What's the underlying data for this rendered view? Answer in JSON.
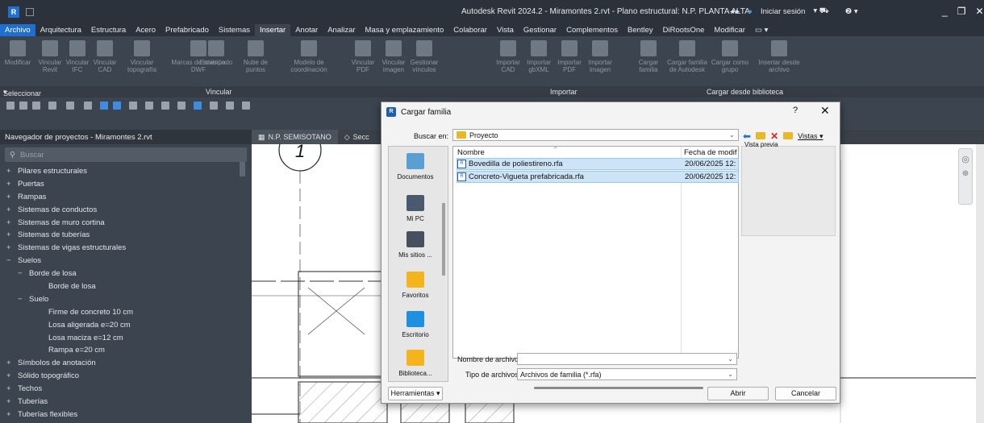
{
  "titlebar": {
    "logo": "R",
    "title": "Autodesk Revit 2024.2 - Miramontes 2.rvt - Plano estructural: N.P. PLANTA ALTA",
    "signin": "Iniciar sesión",
    "cart_icon": "cart-icon",
    "help_icon": "help-icon"
  },
  "menu": [
    "Archivo",
    "Arquitectura",
    "Estructura",
    "Acero",
    "Prefabricado",
    "Sistemas",
    "Insertar",
    "Anotar",
    "Analizar",
    "Masa y emplazamiento",
    "Colaborar",
    "Vista",
    "Gestionar",
    "Complementos",
    "Bentley",
    "DiRootsOne",
    "Modificar"
  ],
  "ribbon": {
    "buttons": [
      "Modificar",
      "Vincular Revit",
      "Vincular IFC",
      "Vincular CAD",
      "Vincular topografía",
      "Marcas de revisión DWF",
      "Estampado",
      "Nube de puntos",
      "Modelo de coordinación",
      "Vincular PDF",
      "Vincular imagen",
      "Gestionar vínculos",
      "Importar CAD",
      "Importar gbXML",
      "Importar PDF",
      "Importar imagen",
      "Cargar familia",
      "Cargar familia de Autodesk",
      "Cargar como grupo",
      "Insertar desde archivo"
    ],
    "panels": [
      "Seleccionar",
      "Vincular",
      "Importar",
      "Cargar desde biblioteca"
    ]
  },
  "tabs": [
    "N.P. SEMISOTANO",
    "Secc"
  ],
  "browser": {
    "title": "Navegador de proyectos - Miramontes 2.rvt",
    "search_placeholder": "Buscar",
    "items": [
      {
        "sym": "+",
        "label": "Pilares estructurales",
        "indent": 1
      },
      {
        "sym": "+",
        "label": "Puertas",
        "indent": 1
      },
      {
        "sym": "+",
        "label": "Rampas",
        "indent": 1
      },
      {
        "sym": "+",
        "label": "Sistemas de conductos",
        "indent": 1
      },
      {
        "sym": "+",
        "label": "Sistemas de muro cortina",
        "indent": 1
      },
      {
        "sym": "+",
        "label": "Sistemas de tuberías",
        "indent": 1
      },
      {
        "sym": "+",
        "label": "Sistemas de vigas estructurales",
        "indent": 1
      },
      {
        "sym": "−",
        "label": "Suelos",
        "indent": 1
      },
      {
        "sym": "−",
        "label": "Borde de losa",
        "indent": 2
      },
      {
        "sym": "",
        "label": "Borde de losa",
        "indent": 3
      },
      {
        "sym": "−",
        "label": "Suelo",
        "indent": 2
      },
      {
        "sym": "",
        "label": "Firme de concreto 10 cm",
        "indent": 3
      },
      {
        "sym": "",
        "label": "Losa aligerada e=20 cm",
        "indent": 3
      },
      {
        "sym": "",
        "label": "Losa maciza e=12 cm",
        "indent": 3
      },
      {
        "sym": "",
        "label": "Rampa e=20 cm",
        "indent": 3
      },
      {
        "sym": "+",
        "label": "Símbolos de anotación",
        "indent": 1
      },
      {
        "sym": "+",
        "label": "Sólido topográfico",
        "indent": 1
      },
      {
        "sym": "+",
        "label": "Techos",
        "indent": 1
      },
      {
        "sym": "+",
        "label": "Tuberías",
        "indent": 1
      },
      {
        "sym": "+",
        "label": "Tuberías flexibles",
        "indent": 1
      }
    ]
  },
  "drawing": {
    "grid_bubble": "1"
  },
  "dialog": {
    "title": "Cargar familia",
    "help": "?",
    "close": "✕",
    "lookin_label": "Buscar en:",
    "lookin_value": "Proyecto",
    "views_label": "Vistas",
    "preview_label": "Vista previa",
    "places": [
      "Documentos",
      "Mi PC",
      "Mis sitios ...",
      "Favoritos",
      "Escritorio",
      "Biblioteca..."
    ],
    "columns": {
      "name": "Nombre",
      "date": "Fecha de modif"
    },
    "files": [
      {
        "name": "Bovedilla de poliestireno.rfa",
        "date": "20/06/2025 12:"
      },
      {
        "name": "Concreto-Vigueta prefabricada.rfa",
        "date": "20/06/2025 12:"
      }
    ],
    "filename_label": "Nombre de archivo:",
    "filename_value": "",
    "filetype_label": "Tipo de archivos:",
    "filetype_value": "Archivos de familia  (*.rfa)",
    "tools_label": "Herramientas",
    "open_label": "Abrir",
    "cancel_label": "Cancelar"
  }
}
